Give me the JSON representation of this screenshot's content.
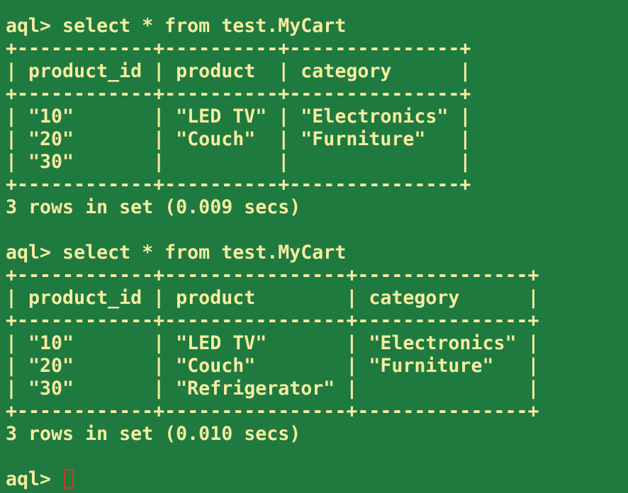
{
  "terminal": {
    "background": "#1f7a40",
    "text_color": "#f5eda0",
    "cursor_color": "#c83a2a",
    "lines": [
      "aql> select * from test.MyCart",
      "+------------+----------+---------------+",
      "| product_id | product  | category      |",
      "+------------+----------+---------------+",
      "| \"10\"       | \"LED TV\" | \"Electronics\" |",
      "| \"20\"       | \"Couch\"  | \"Furniture\"   |",
      "| \"30\"       |          |               |",
      "+------------+----------+---------------+",
      "3 rows in set (0.009 secs)",
      "",
      "aql> select * from test.MyCart",
      "+------------+----------------+---------------+",
      "| product_id | product        | category      |",
      "+------------+----------------+---------------+",
      "| \"10\"       | \"LED TV\"       | \"Electronics\" |",
      "| \"20\"       | \"Couch\"        | \"Furniture\"   |",
      "| \"30\"       | \"Refrigerator\" |               |",
      "+------------+----------------+---------------+",
      "3 rows in set (0.010 secs)",
      "",
      "aql> "
    ]
  }
}
